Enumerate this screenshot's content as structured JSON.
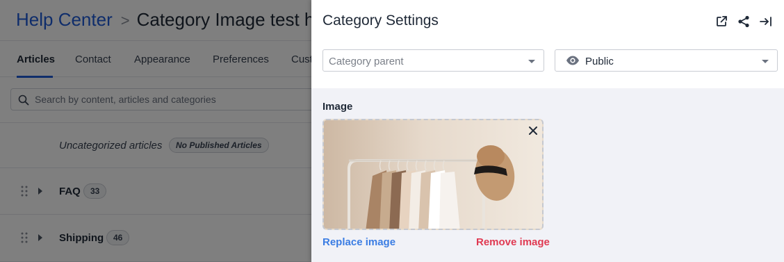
{
  "header": {
    "breadcrumb_root": "Help Center",
    "breadcrumb_separator": ">",
    "breadcrumb_current": "Category Image test he"
  },
  "tabs": [
    {
      "label": "Articles",
      "active": true
    },
    {
      "label": "Contact"
    },
    {
      "label": "Appearance"
    },
    {
      "label": "Preferences"
    },
    {
      "label": "Cust"
    }
  ],
  "search": {
    "placeholder": "Search by content, articles and categories",
    "icon": "search-icon"
  },
  "list": {
    "uncategorized": {
      "label": "Uncategorized articles",
      "badge": "No Published Articles"
    },
    "categories": [
      {
        "name": "FAQ",
        "count": "33"
      },
      {
        "name": "Shipping",
        "count": "46"
      }
    ]
  },
  "panel": {
    "title": "Category Settings",
    "header_icons": [
      "open-external-icon",
      "share-icon",
      "collapse-panel-icon"
    ],
    "category_parent_placeholder": "Category parent",
    "visibility_value": "Public",
    "visibility_icon": "eye-icon",
    "image_label": "Image",
    "replace_image": "Replace image",
    "remove_image": "Remove image"
  },
  "colors": {
    "brand_link": "#1f5bd6",
    "replace_link": "#3b7de3",
    "remove_link": "#e03a52",
    "panel_bg": "#f1f2f7"
  }
}
